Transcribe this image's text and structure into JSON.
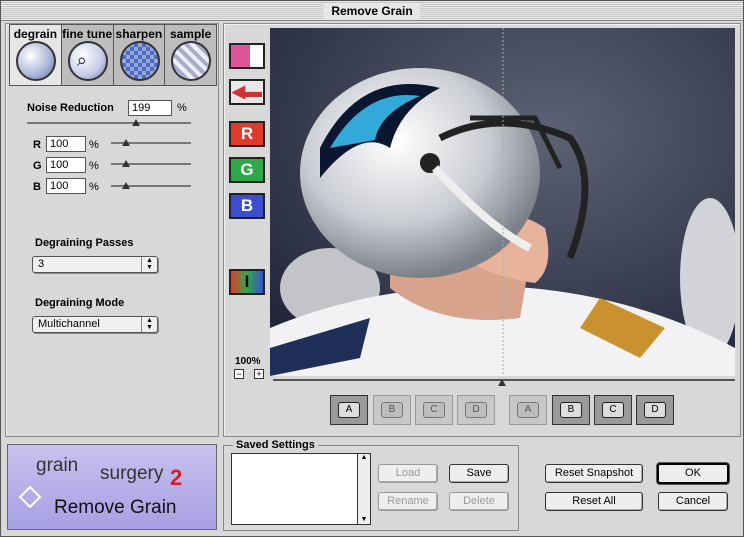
{
  "window": {
    "title": "Remove Grain"
  },
  "tabs": [
    {
      "label": "degrain"
    },
    {
      "label": "fine tune"
    },
    {
      "label": "sharpen"
    },
    {
      "label": "sample"
    }
  ],
  "noise": {
    "label": "Noise Reduction",
    "value": "199",
    "unit": "%",
    "channels": [
      {
        "label": "R",
        "value": "100",
        "unit": "%"
      },
      {
        "label": "G",
        "value": "100",
        "unit": "%"
      },
      {
        "label": "B",
        "value": "100",
        "unit": "%"
      }
    ]
  },
  "passes": {
    "label": "Degraining Passes",
    "value": "3"
  },
  "mode": {
    "label": "Degraining Mode",
    "value": "Multichannel"
  },
  "view_buttons": {
    "r": "R",
    "g": "G",
    "b": "B",
    "i": "I"
  },
  "zoom": {
    "level": "100%",
    "minus": "−",
    "plus": "+"
  },
  "snapshots": [
    "A",
    "B",
    "C",
    "D"
  ],
  "compare": [
    "A",
    "B",
    "C",
    "D"
  ],
  "saved": {
    "title": "Saved Settings",
    "load": "Load",
    "save": "Save",
    "rename": "Rename",
    "delete": "Delete"
  },
  "actions": {
    "reset_snapshot": "Reset Snapshot",
    "ok": "OK",
    "reset_all": "Reset All",
    "cancel": "Cancel"
  },
  "logo": {
    "line1": "grain",
    "line2": "surgery",
    "badge": "2",
    "caption": "Remove Grain"
  },
  "colors": {
    "accent_r": "#e03a2a",
    "accent_g": "#2fa84a",
    "accent_b": "#3a4fcf",
    "logo_bg": "#b9b2e8"
  }
}
